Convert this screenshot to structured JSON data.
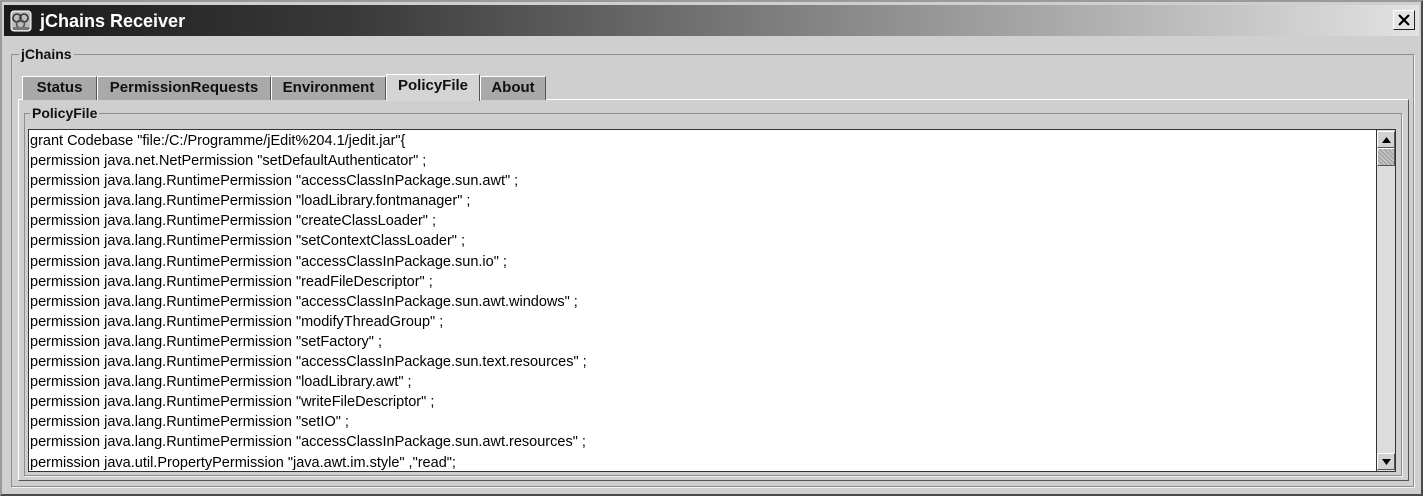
{
  "window": {
    "title": "jChains Receiver",
    "icon": "jchains-app-icon",
    "close_icon": "close-icon"
  },
  "outer_group": {
    "label": "jChains"
  },
  "tabs": [
    {
      "label": "Status",
      "active": false
    },
    {
      "label": "PermissionRequests",
      "active": false
    },
    {
      "label": "Environment",
      "active": false
    },
    {
      "label": "PolicyFile",
      "active": true
    },
    {
      "label": "About",
      "active": false
    }
  ],
  "policy_panel": {
    "label": "PolicyFile",
    "lines": [
      "grant Codebase \"file:/C:/Programme/jEdit%204.1/jedit.jar\"{",
      "permission java.net.NetPermission \"setDefaultAuthenticator\" ;",
      "permission java.lang.RuntimePermission \"accessClassInPackage.sun.awt\" ;",
      "permission java.lang.RuntimePermission \"loadLibrary.fontmanager\" ;",
      "permission java.lang.RuntimePermission \"createClassLoader\" ;",
      "permission java.lang.RuntimePermission \"setContextClassLoader\" ;",
      "permission java.lang.RuntimePermission \"accessClassInPackage.sun.io\" ;",
      "permission java.lang.RuntimePermission \"readFileDescriptor\" ;",
      "permission java.lang.RuntimePermission \"accessClassInPackage.sun.awt.windows\" ;",
      "permission java.lang.RuntimePermission \"modifyThreadGroup\" ;",
      "permission java.lang.RuntimePermission \"setFactory\" ;",
      "permission java.lang.RuntimePermission \"accessClassInPackage.sun.text.resources\" ;",
      "permission java.lang.RuntimePermission \"loadLibrary.awt\" ;",
      "permission java.lang.RuntimePermission \"writeFileDescriptor\" ;",
      "permission java.lang.RuntimePermission \"setIO\" ;",
      "permission java.lang.RuntimePermission \"accessClassInPackage.sun.awt.resources\" ;",
      "permission java.util.PropertyPermission \"java.awt.im.style\" ,\"read\";"
    ]
  },
  "scrollbar": {
    "up_icon": "arrow-up-icon",
    "down_icon": "arrow-down-icon",
    "position": 0
  }
}
